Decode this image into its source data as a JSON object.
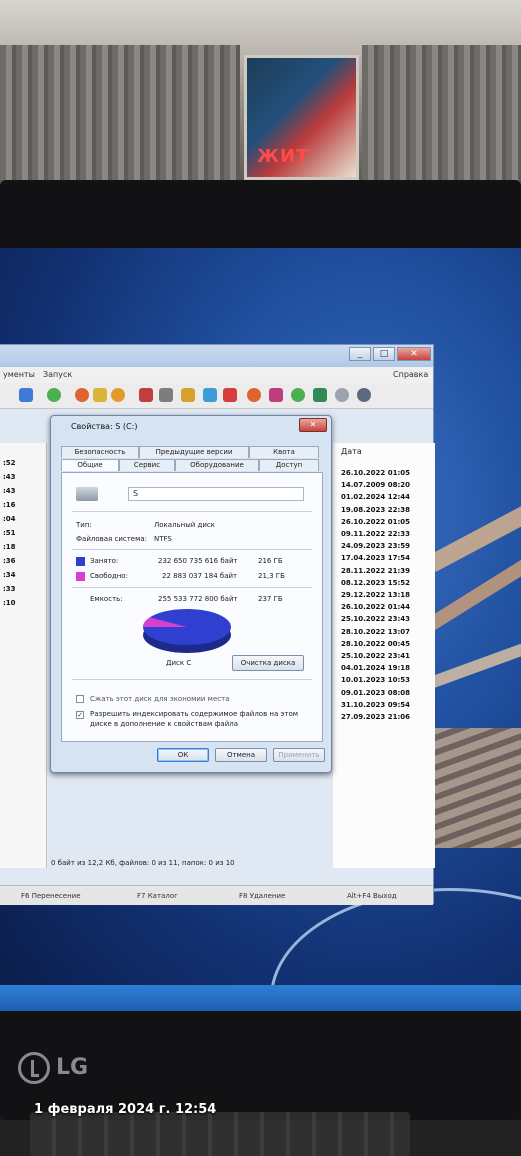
{
  "photo": {
    "timestamp": "1 февраля 2024 г. 12:54",
    "poster_text": "ЖИТ",
    "monitor_brand": "LG"
  },
  "file_manager": {
    "menu": {
      "documents": "ументы",
      "launch": "Запуск",
      "help": "Справка"
    },
    "left_times": [
      ":52",
      ":43",
      ":43",
      ":16",
      ":04",
      ":51",
      ":18",
      ":36",
      ":34",
      ":33",
      ":10"
    ],
    "date_column_header": "Дата",
    "dates": [
      "26.10.2022 01:05",
      "14.07.2009 08:20",
      "01.02.2024 12:44",
      "19.08.2023 22:38",
      "26.10.2022 01:05",
      "09.11.2022 22:33",
      "24.09.2023 23:59",
      "17.04.2023 17:54",
      "28.11.2022 21:39",
      "08.12.2023 15:52",
      "29.12.2022 13:18",
      "26.10.2022 01:44",
      "25.10.2022 23:43",
      "28.10.2022 13:07",
      "28.10.2022 00:45",
      "25.10.2022 23:41",
      "04.01.2024 19:18",
      "10.01.2023 10:53",
      "09.01.2023 08:08",
      "31.10.2023 09:54",
      "27.09.2023 21:06"
    ],
    "status": "0 байт из 12,2 Кб, файлов: 0 из 11, папок: 0 из 10",
    "fkeys": [
      "F6 Перенесение",
      "F7 Каталог",
      "F8 Удаление",
      "Alt+F4 Выход"
    ]
  },
  "dialog": {
    "title": "Свойства: S (C:)",
    "close_glyph": "✕",
    "tabs_top": [
      "Безопасность",
      "Предыдущие версии",
      "Квота"
    ],
    "tabs_bottom": [
      "Общие",
      "Сервис",
      "Оборудование",
      "Доступ"
    ],
    "drive_label": "S",
    "type_label": "Тип:",
    "type_value": "Локальный диск",
    "fs_label": "Файловая система:",
    "fs_value": "NTFS",
    "used_label": "Занято:",
    "used_bytes": "232 650 735 616 байт",
    "used_gb": "216 ГБ",
    "free_label": "Свободно:",
    "free_bytes": "22 883 037 184 байт",
    "free_gb": "21,3 ГБ",
    "capacity_label": "Емкость:",
    "capacity_bytes": "255 533 772 800 байт",
    "capacity_gb": "237 ГБ",
    "disk_caption": "Диск C",
    "cleanup_button": "Очистка диска",
    "compress_label": "Сжать этот диск для экономии места",
    "index_label_1": "Разрешить индексировать содержимое файлов на этом",
    "index_label_2": "диске в дополнение к свойствам файла",
    "ok": "ОК",
    "cancel": "Отмена",
    "apply": "Применить",
    "used_fraction": 0.91,
    "used_color": "#2f3fd0",
    "free_color": "#d63fd0"
  }
}
